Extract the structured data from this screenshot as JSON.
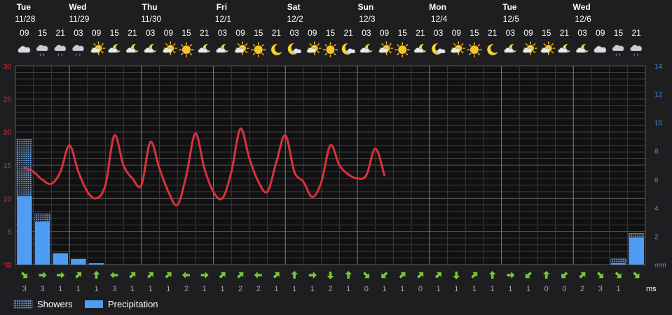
{
  "chart_data": {
    "type": "meteogram",
    "days": [
      {
        "dow": "Tue",
        "date": "11/28"
      },
      {
        "dow": "Wed",
        "date": "11/29"
      },
      {
        "dow": "Thu",
        "date": "11/30"
      },
      {
        "dow": "Fri",
        "date": "12/1"
      },
      {
        "dow": "Sat",
        "date": "12/2"
      },
      {
        "dow": "Sun",
        "date": "12/3"
      },
      {
        "dow": "Mon",
        "date": "12/4"
      },
      {
        "dow": "Tue",
        "date": "12/5"
      },
      {
        "dow": "Wed",
        "date": "12/6"
      }
    ],
    "hours": [
      "09",
      "15",
      "21",
      "03",
      "09",
      "15",
      "21",
      "03",
      "09",
      "15",
      "21",
      "03",
      "09",
      "15",
      "21",
      "03",
      "09",
      "15",
      "21",
      "03",
      "09",
      "15",
      "21",
      "03",
      "09",
      "15",
      "21",
      "03",
      "09",
      "15",
      "21",
      "03",
      "09",
      "15",
      "21"
    ],
    "weather_icons": [
      "cloudy",
      "cloudy-rain",
      "cloudy-rain",
      "cloudy-rain",
      "partly-sunny",
      "partly-cloudy-night",
      "partly-cloudy-night",
      "partly-cloudy-night",
      "partly-sunny",
      "sunny",
      "partly-cloudy-night",
      "partly-cloudy-night",
      "partly-sunny",
      "sunny",
      "moon",
      "moon-cloud",
      "partly-sunny",
      "sunny",
      "moon-cloud",
      "partly-cloudy-night",
      "partly-sunny",
      "sunny",
      "partly-cloudy-night",
      "moon-cloud",
      "partly-sunny",
      "sunny",
      "moon",
      "partly-cloudy-night",
      "partly-sunny",
      "partly-sunny",
      "partly-cloudy-night",
      "partly-cloudy-night",
      "cloudy",
      "cloudy-rain",
      "cloudy-rain"
    ],
    "temperature": [
      14.6,
      14.0,
      12.8,
      12.2,
      14.0,
      18.0,
      14.0,
      11.0,
      10.0,
      12.0,
      19.5,
      15.0,
      13.0,
      12.0,
      18.5,
      14.5,
      11.0,
      9.0,
      13.5,
      19.8,
      14.5,
      11.0,
      10.0,
      14.0,
      20.5,
      16.0,
      12.5,
      11.0,
      15.5,
      19.5,
      14.0,
      12.5,
      10.2,
      12.5,
      18.0,
      15.0,
      13.6,
      13.0,
      13.5,
      17.5,
      13.5
    ],
    "temperature_hours": [
      "09",
      "12",
      "15",
      "18",
      "21",
      "00",
      "03",
      "06",
      "09",
      "12",
      "15",
      "18",
      "21",
      "00",
      "03",
      "06",
      "09",
      "12",
      "15",
      "18",
      "21",
      "00",
      "03",
      "06",
      "09",
      "12",
      "15",
      "18",
      "21",
      "00",
      "03",
      "06",
      "09",
      "12",
      "15",
      "18",
      "21",
      "00",
      "03",
      "06",
      "09"
    ],
    "precipitation_mm": [
      4.8,
      3.0,
      0.8,
      0.4,
      0.1,
      0,
      0,
      0,
      0,
      0,
      0,
      0,
      0,
      0,
      0,
      0,
      0,
      0,
      0,
      0,
      0,
      0,
      0,
      0,
      0,
      0,
      0,
      0,
      0,
      0,
      0,
      0,
      0,
      0.1,
      1.9
    ],
    "showers_mm": [
      4.0,
      0.6,
      0,
      0,
      0,
      0,
      0,
      0,
      0,
      0,
      0,
      0,
      0,
      0,
      0,
      0,
      0,
      0,
      0,
      0,
      0,
      0,
      0,
      0,
      0,
      0,
      0,
      0,
      0,
      0,
      0,
      0,
      0,
      0.3,
      0.3
    ],
    "wind_dir": [
      "SE",
      "E",
      "E",
      "NE",
      "N",
      "W",
      "NE",
      "NE",
      "NE",
      "W",
      "E",
      "NE",
      "NE",
      "W",
      "NE",
      "N",
      "E",
      "S",
      "N",
      "SE",
      "SW",
      "NE",
      "NE",
      "NE",
      "S",
      "NE",
      "N",
      "E",
      "SW",
      "N",
      "SW",
      "NE",
      "SE",
      "SE",
      "SE"
    ],
    "wind_speed": [
      3,
      3,
      1,
      1,
      1,
      3,
      1,
      1,
      1,
      2,
      1,
      1,
      2,
      2,
      1,
      1,
      1,
      2,
      1,
      0,
      1,
      1,
      0,
      1,
      1,
      1,
      1,
      1,
      1,
      0,
      0,
      2,
      3,
      1
    ],
    "ylabel_left": "°C",
    "ylabel_right": "mm",
    "wind_unit": "ms",
    "ylim_left": [
      0,
      30
    ],
    "ylim_right": [
      0,
      14
    ],
    "left_ticks": [
      30,
      25,
      20,
      15,
      10,
      5,
      0
    ],
    "right_ticks": [
      14,
      12,
      10,
      8,
      6,
      4,
      2
    ],
    "legend": [
      {
        "name": "Showers",
        "style": "dotted"
      },
      {
        "name": "Precipitation",
        "style": "solid"
      }
    ],
    "colors": {
      "temperature": "#d8323a",
      "precipitation": "#4f9cf5",
      "showers": "#4f9cf5",
      "wind_arrow": "#7cc43a",
      "left_axis": "#d8323a",
      "right_axis": "#3f8ff0",
      "grid": "#505050",
      "background": "#1e1e20"
    }
  }
}
